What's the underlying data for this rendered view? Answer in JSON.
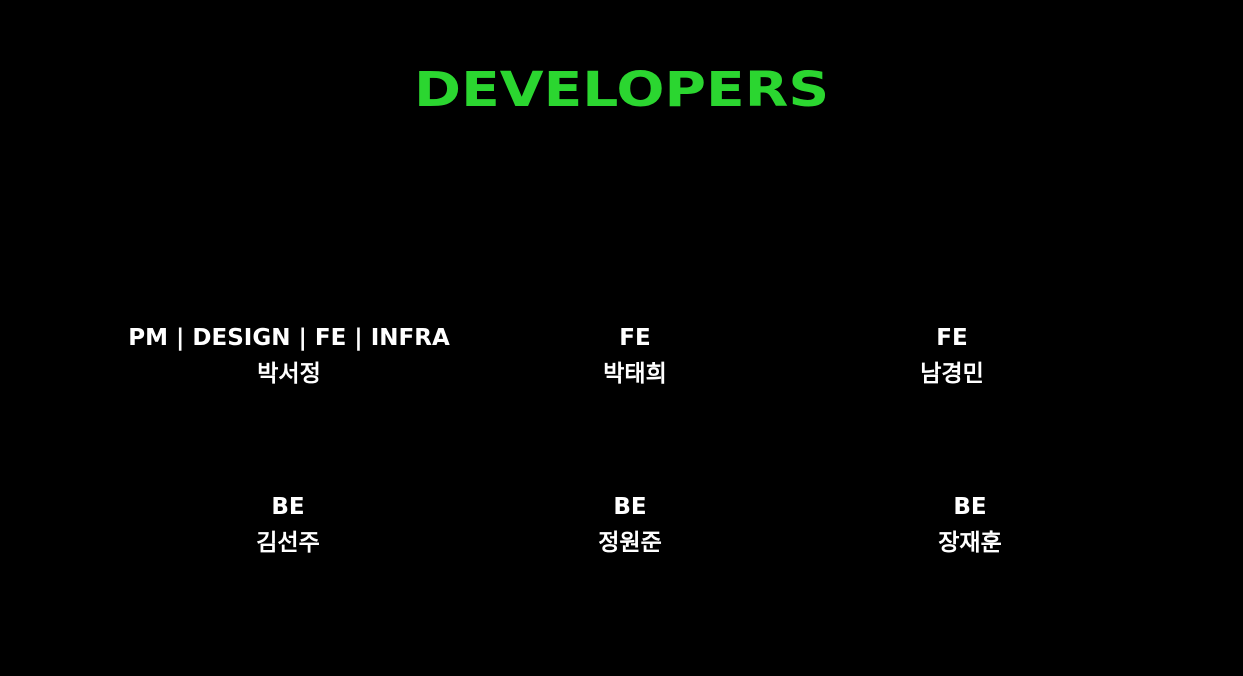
{
  "title": "DEVELOPERS",
  "members": [
    {
      "role": "PM | DESIGN | FE | INFRA",
      "name": "박서정"
    },
    {
      "role": "FE",
      "name": "박태희"
    },
    {
      "role": "FE",
      "name": "남경민"
    },
    {
      "role": "BE",
      "name": "김선주"
    },
    {
      "role": "BE",
      "name": "정원준"
    },
    {
      "role": "BE",
      "name": "장재훈"
    }
  ],
  "colors": {
    "background": "#000000",
    "accent": "#2bd630",
    "text": "#ffffff"
  }
}
